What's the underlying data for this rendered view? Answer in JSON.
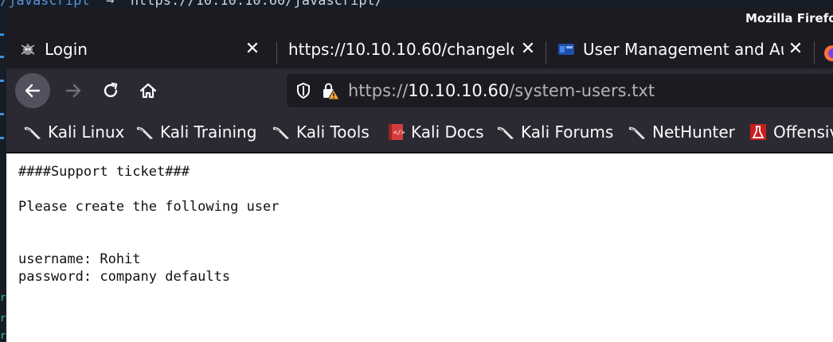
{
  "terminal": {
    "visible_line": {
      "path": "/javascript",
      "arrow": "→",
      "url": "https://10.10.10.60/javascript/"
    }
  },
  "window": {
    "title": "Mozilla Firefo"
  },
  "tabs": [
    {
      "label": "Login",
      "favicon": "bug-icon",
      "active": true
    },
    {
      "label": "https://10.10.10.60/changelo",
      "favicon": "",
      "active": false
    },
    {
      "label": "User Management and Au",
      "favicon": "blue-app-icon",
      "active": false
    }
  ],
  "navbar": {
    "url_scheme": "https://",
    "url_host": "10.10.10.60",
    "url_path": "/system-users.txt"
  },
  "bookmarks": [
    {
      "label": "Kali Linux",
      "icon": "kali-dragon-icon"
    },
    {
      "label": "Kali Training",
      "icon": "kali-dragon-icon"
    },
    {
      "label": "Kali Tools",
      "icon": "kali-dragon-icon"
    },
    {
      "label": "Kali Docs",
      "icon": "kali-docs-icon"
    },
    {
      "label": "Kali Forums",
      "icon": "kali-dragon-icon"
    },
    {
      "label": "NetHunter",
      "icon": "kali-dragon-icon"
    },
    {
      "label": "Offensiv",
      "icon": "offsec-flask-icon"
    }
  ],
  "page": {
    "lines": [
      "####Support ticket###",
      "",
      "Please create the following user",
      "",
      "",
      "username: Rohit",
      "password: company defaults"
    ]
  },
  "colors": {
    "toolbar": "#2b2a33",
    "tabstrip": "#1c1b22",
    "back_button_bg": "#52525e",
    "page_bg": "#ffffff",
    "warning_triangle": "#ffa436"
  }
}
